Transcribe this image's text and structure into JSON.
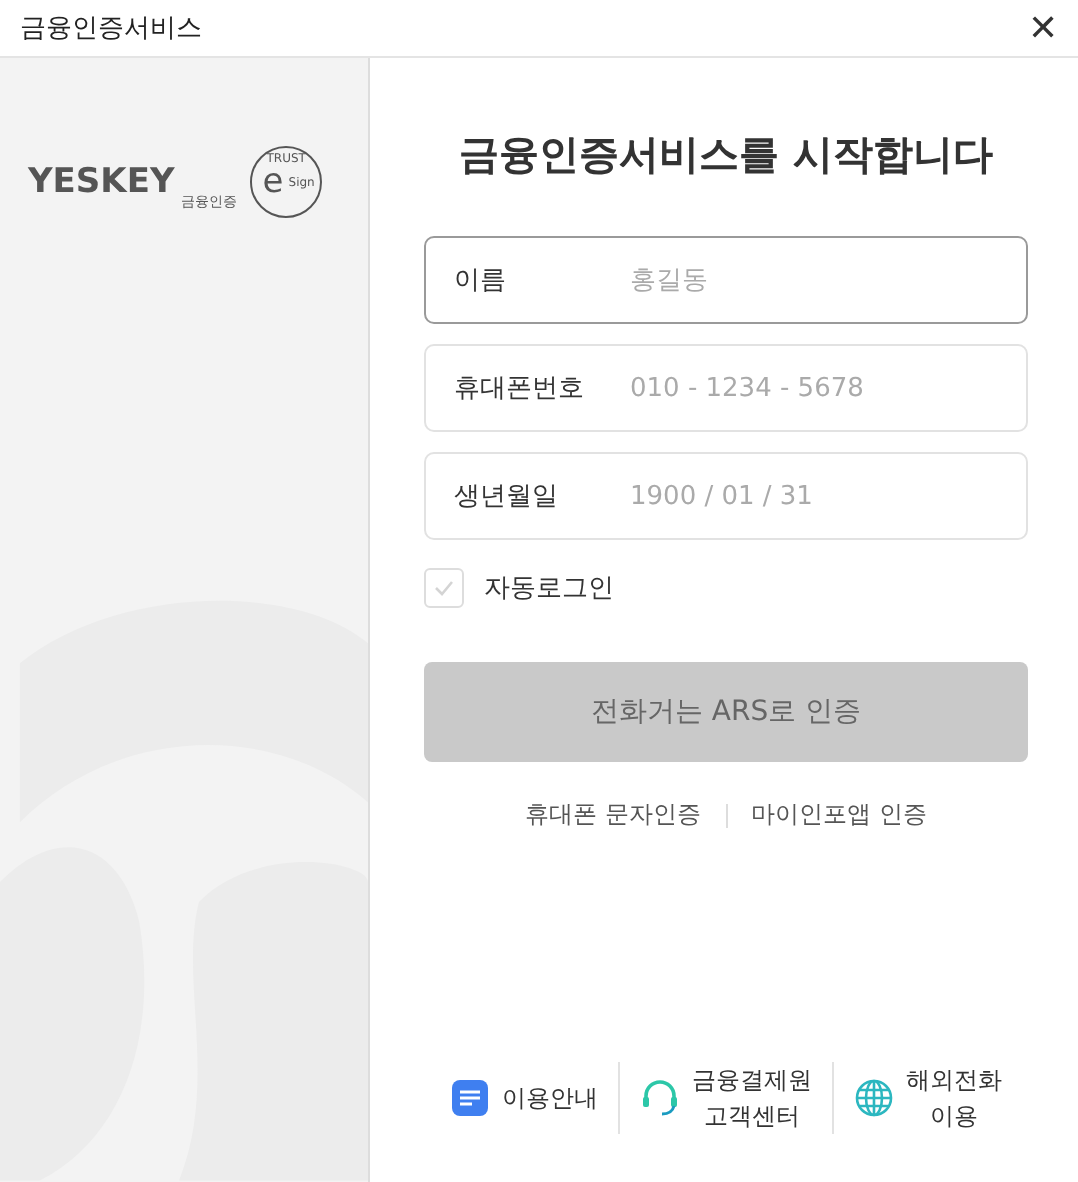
{
  "window": {
    "title": "금융인증서비스",
    "close": "✕"
  },
  "logo": {
    "brand": "YESKEY",
    "sub": "금융인증",
    "seal_top": "TRUST",
    "seal_letter": "e",
    "seal_side": "Sign"
  },
  "heading": "금융인증서비스를 시작합니다",
  "fields": [
    {
      "label": "이름",
      "placeholder": "홍길동",
      "focused": true
    },
    {
      "label": "휴대폰번호",
      "placeholder": "010 - 1234 - 5678",
      "focused": false
    },
    {
      "label": "생년월일",
      "placeholder": "1900 / 01 / 31",
      "focused": false
    }
  ],
  "auto_login": {
    "label": "자동로그인",
    "checked": false
  },
  "submit": {
    "label": "전화거는 ARS로 인증",
    "disabled": true
  },
  "links": [
    "휴대폰 문자인증",
    "마이인포앱 인증"
  ],
  "footer": [
    {
      "kind": "guide",
      "lines": [
        "이용안내"
      ]
    },
    {
      "kind": "support",
      "lines": [
        "금융결제원",
        "고객센터"
      ]
    },
    {
      "kind": "global",
      "lines": [
        "해외전화",
        "이용"
      ]
    }
  ]
}
